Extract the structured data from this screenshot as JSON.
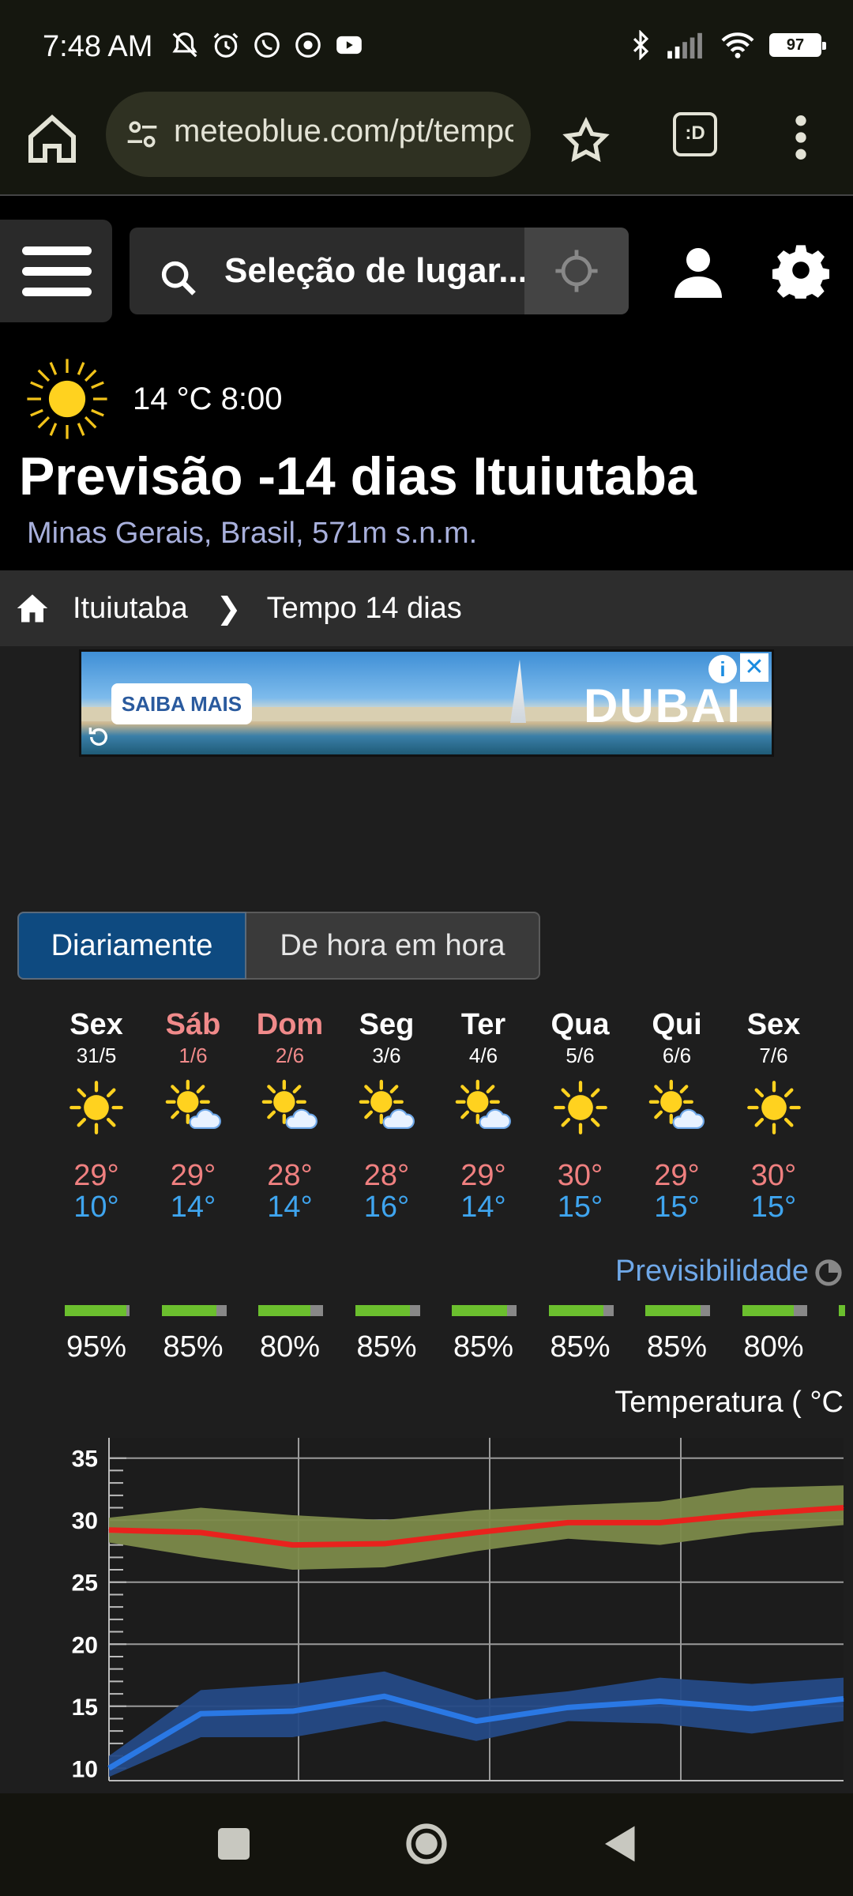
{
  "status_bar": {
    "time": "7:48 AM",
    "battery": "97"
  },
  "browser": {
    "url": "meteoblue.com/pt/tempo/semana/ituiutaba",
    "tabs_label": ":D"
  },
  "site": {
    "search_placeholder": "Seleção de lugar...",
    "current_temp": "14 °C  8:00",
    "title": "Previsão -14 dias Ituiutaba",
    "subtitle": "Minas Gerais, Brasil, 571m s.n.m."
  },
  "breadcrumb": {
    "home_label": "Ituiutaba",
    "separator": "❯",
    "current": "Tempo 14 dias"
  },
  "ad": {
    "button_label": "SAIBA MAIS",
    "brand": "DUBAI",
    "info": "i",
    "close": "✕"
  },
  "view_toggle": {
    "active": "Diariamente",
    "inactive": "De hora em hora"
  },
  "days": [
    {
      "name": "Sex",
      "date": "31/5",
      "weekend": false,
      "icon": "sun-icon",
      "max": "29°",
      "min": "10°",
      "predictability": "95%",
      "pred_fraction": 0.95
    },
    {
      "name": "Sáb",
      "date": "1/6",
      "weekend": true,
      "icon": "sun-cloud-icon",
      "max": "29°",
      "min": "14°",
      "predictability": "85%",
      "pred_fraction": 0.85
    },
    {
      "name": "Dom",
      "date": "2/6",
      "weekend": true,
      "icon": "sun-cloud-icon",
      "max": "28°",
      "min": "14°",
      "predictability": "80%",
      "pred_fraction": 0.8
    },
    {
      "name": "Seg",
      "date": "3/6",
      "weekend": false,
      "icon": "sun-cloud-icon",
      "max": "28°",
      "min": "16°",
      "predictability": "85%",
      "pred_fraction": 0.85
    },
    {
      "name": "Ter",
      "date": "4/6",
      "weekend": false,
      "icon": "sun-cloud-icon",
      "max": "29°",
      "min": "14°",
      "predictability": "85%",
      "pred_fraction": 0.85
    },
    {
      "name": "Qua",
      "date": "5/6",
      "weekend": false,
      "icon": "sun-icon",
      "max": "30°",
      "min": "15°",
      "predictability": "85%",
      "pred_fraction": 0.85
    },
    {
      "name": "Qui",
      "date": "6/6",
      "weekend": false,
      "icon": "sun-cloud-icon",
      "max": "29°",
      "min": "15°",
      "predictability": "85%",
      "pred_fraction": 0.85
    },
    {
      "name": "Sex",
      "date": "7/6",
      "weekend": false,
      "icon": "sun-icon",
      "max": "30°",
      "min": "15°",
      "predictability": "80%",
      "pred_fraction": 0.8
    }
  ],
  "predictability_label": "Previsibilidade",
  "chart_data": {
    "type": "line",
    "title": "Temperatura ( °C",
    "ylim": [
      9,
      36
    ],
    "yticks": [
      10,
      15,
      20,
      25,
      30,
      35
    ],
    "grid": true,
    "series": [
      {
        "color": "#e8221d",
        "band_color": "#7c8a4a",
        "values": [
          29.2,
          29.0,
          28.0,
          28.1,
          29.0,
          29.8,
          29.8,
          30.5,
          31.0
        ],
        "band_low": [
          28.2,
          27.0,
          26.0,
          26.2,
          27.5,
          28.5,
          28.0,
          29.0,
          29.6
        ],
        "band_high": [
          30.2,
          31.0,
          30.4,
          30.0,
          30.8,
          31.2,
          31.5,
          32.6,
          32.8
        ]
      },
      {
        "color": "#2a78e4",
        "band_color": "#254a86",
        "values": [
          10.0,
          14.4,
          14.6,
          15.8,
          13.8,
          14.9,
          15.4,
          14.8,
          15.6
        ],
        "band_low": [
          9.3,
          12.5,
          12.5,
          13.8,
          12.2,
          13.8,
          13.6,
          12.8,
          13.8
        ],
        "band_high": [
          11.0,
          16.3,
          16.8,
          17.8,
          15.5,
          16.2,
          17.3,
          16.8,
          17.3
        ]
      }
    ]
  }
}
